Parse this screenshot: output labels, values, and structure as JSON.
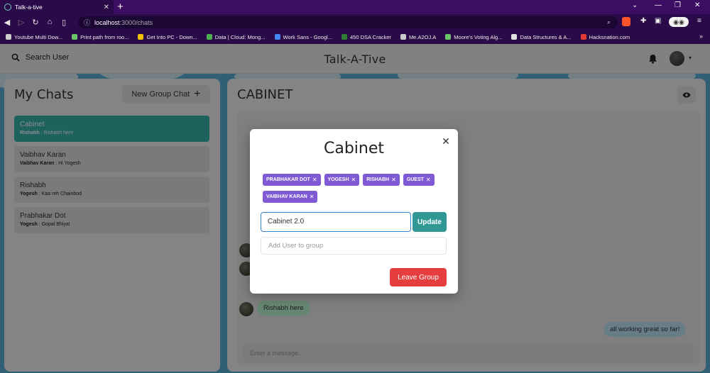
{
  "browser": {
    "tab_title": "Talk-a-tive",
    "tab_close": "✕",
    "new_tab": "+",
    "url_host": "localhost",
    "url_path": ":3000/chats",
    "bookmarks": [
      {
        "label": "Youtube Multi Dow...",
        "color": "#cccccc"
      },
      {
        "label": "Print path from roo...",
        "color": "#6ac46a"
      },
      {
        "label": "Get Into PC - Down...",
        "color": "#f0c000"
      },
      {
        "label": "Data | Cloud: Mong...",
        "color": "#4caf50"
      },
      {
        "label": "Work Sans - Googl...",
        "color": "#4285f4"
      },
      {
        "label": "450 DSA Cracker",
        "color": "#2e7d32"
      },
      {
        "label": "Me.A2OJ.A",
        "color": "#cccccc"
      },
      {
        "label": "Moore's Voting Alg...",
        "color": "#6ac46a"
      },
      {
        "label": "Data Structures & A...",
        "color": "#e0e0e0"
      },
      {
        "label": "Hacksnation.com",
        "color": "#e53935"
      }
    ],
    "bookmarks_more": "»"
  },
  "header": {
    "search_label": "Search User",
    "app_title": "Talk-A-Tive"
  },
  "chats": {
    "title": "My Chats",
    "new_group_label": "New Group Chat",
    "new_group_icon": "+",
    "items": [
      {
        "name": "Cabinet",
        "sender": "Rishabh",
        "message": "Rishabh here",
        "active": true
      },
      {
        "name": "Vaibhav Karan",
        "sender": "Vaibhav Karan",
        "message": "Hi Yogesh",
        "active": false
      },
      {
        "name": "Rishabh",
        "sender": "Yogesh",
        "message": "Kaa reh Chainbod",
        "active": false
      },
      {
        "name": "Prabhakar Dot",
        "sender": "Yogesh",
        "message": "Gopal Bhiya!",
        "active": false
      }
    ]
  },
  "conversation": {
    "title": "CABINET",
    "messages_in": [
      "Rishabh here"
    ],
    "messages_out": [
      "all working great so far!"
    ],
    "input_placeholder": "Enter a message.."
  },
  "modal": {
    "title": "Cabinet",
    "close_icon": "✕",
    "members": [
      "PRABHAKAR DOT",
      "YOGESH",
      "RISHABH",
      "GUEST",
      "VAIBHAV KARAN"
    ],
    "remove_icon": "✕",
    "group_name_value": "Cabinet 2.0",
    "update_label": "Update",
    "add_user_placeholder": "Add User to group",
    "leave_label": "Leave Group"
  },
  "colors": {
    "accent": "#38b2ac",
    "badge": "#805ad5",
    "update": "#319795",
    "leave": "#e53e3e",
    "browser_bar": "#3c0d63"
  }
}
